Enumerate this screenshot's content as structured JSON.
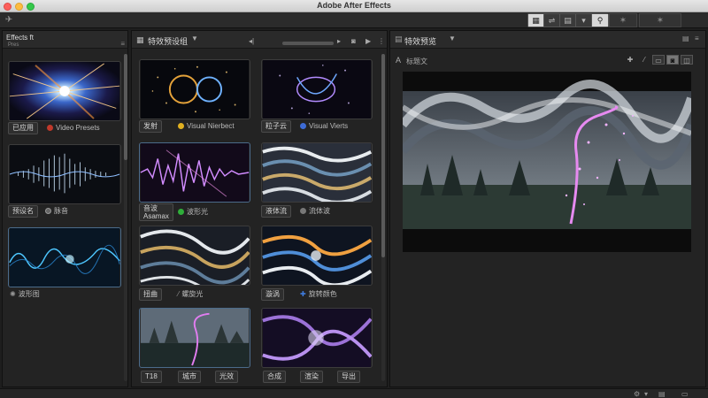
{
  "app": {
    "title": "Adobe After Effects"
  },
  "toolbar": {
    "left_icon": "pin-icon",
    "group_icons": [
      "workspace-icon",
      "split-icon",
      "layers-icon",
      "filter-icon",
      "search-icon"
    ],
    "star_icons": [
      "star-icon",
      "star-icon",
      "star-icon"
    ]
  },
  "effects_panel": {
    "tab_label": "Effects",
    "tab_suffix": "ft",
    "tab_sub": "Pres",
    "items": [
      {
        "chip": "已应用",
        "caption": "Video Presets",
        "dot_color": "#c0392b"
      },
      {
        "chip": "预设名",
        "caption": "脉音",
        "dot_color": "#666666"
      },
      {
        "chip": "",
        "caption": "波形图",
        "dot_color": "#777777"
      }
    ]
  },
  "grid_panel": {
    "title": "特效预设组",
    "rows": [
      {
        "left": {
          "chip": "发射",
          "caption": "Visual Nierbect",
          "dot_color": "#e0b020"
        },
        "right": {
          "chip": "粒子云",
          "caption": "Visual Vierts",
          "dot_color": "#3d6bd6"
        }
      },
      {
        "left": {
          "chip": "音波\nAsamax",
          "caption": "波形光",
          "dot_color": "#2fae3a"
        },
        "right": {
          "chip": "液体流",
          "caption": "流体波",
          "dot_color": "#777777"
        }
      },
      {
        "left": {
          "chip": "扭曲",
          "caption": "螺旋光",
          "dot_color": "#888888"
        },
        "right": {
          "chip": "漩涡",
          "caption": "旋转颜色",
          "dot_color": "#2f6fd6"
        }
      },
      {
        "left": {
          "chips": [
            "T18",
            "城市",
            "光效"
          ]
        },
        "right": {
          "chips": [
            "合成",
            "渲染",
            "导出"
          ]
        }
      }
    ]
  },
  "preview_panel": {
    "title": "特效预览",
    "sub_label": "标题文",
    "tools": [
      "fit-icon",
      "ruler-icon",
      "grid-icon",
      "snapshot-icon",
      "channel-icon"
    ]
  },
  "statusbar": {
    "items": [
      "settings-icon",
      "caret-icon",
      "list-icon",
      "panel-icon"
    ]
  }
}
